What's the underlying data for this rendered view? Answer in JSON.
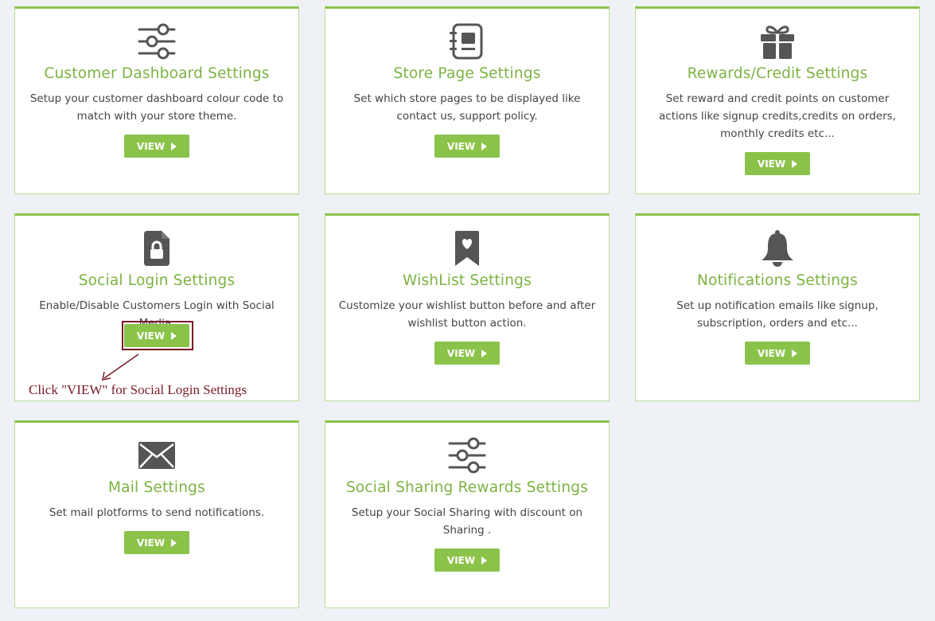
{
  "colors": {
    "accent": "#8bc34a",
    "title": "#7cb342",
    "icon": "#555555",
    "annotation": "#7b1a28",
    "background": "#eef1f6"
  },
  "cards": [
    {
      "title": "Customer Dashboard Settings",
      "description": "Setup your customer dashboard colour code to match with your store theme.",
      "button": "VIEW",
      "icon": "sliders-icon"
    },
    {
      "title": "Store Page Settings",
      "description": "Set which store pages to be displayed like contact us, support policy.",
      "button": "VIEW",
      "icon": "notebook-icon"
    },
    {
      "title": "Rewards/Credit Settings",
      "description": "Set reward and credit points on customer actions like signup credits,credits on orders, monthly credits etc...",
      "button": "VIEW",
      "icon": "gift-icon"
    },
    {
      "title": "Social Login Settings",
      "description": "Enable/Disable Customers Login with Social Media.",
      "button": "VIEW",
      "icon": "file-lock-icon"
    },
    {
      "title": "WishList Settings",
      "description": "Customize your wishlist button before and after wishlist button action.",
      "button": "VIEW",
      "icon": "bookmark-heart-icon"
    },
    {
      "title": "Notifications Settings",
      "description": "Set up notification emails like signup, subscription, orders and etc...",
      "button": "VIEW",
      "icon": "bell-icon"
    },
    {
      "title": "Mail Settings",
      "description": "Set mail plotforms to send notifications.",
      "button": "VIEW",
      "icon": "envelope-icon"
    },
    {
      "title": "Social Sharing Rewards Settings",
      "description": "Setup your Social Sharing with discount on Sharing .",
      "button": "VIEW",
      "icon": "sliders-icon"
    }
  ],
  "annotation": {
    "text": "Click \"VIEW\" for Social Login Settings"
  }
}
